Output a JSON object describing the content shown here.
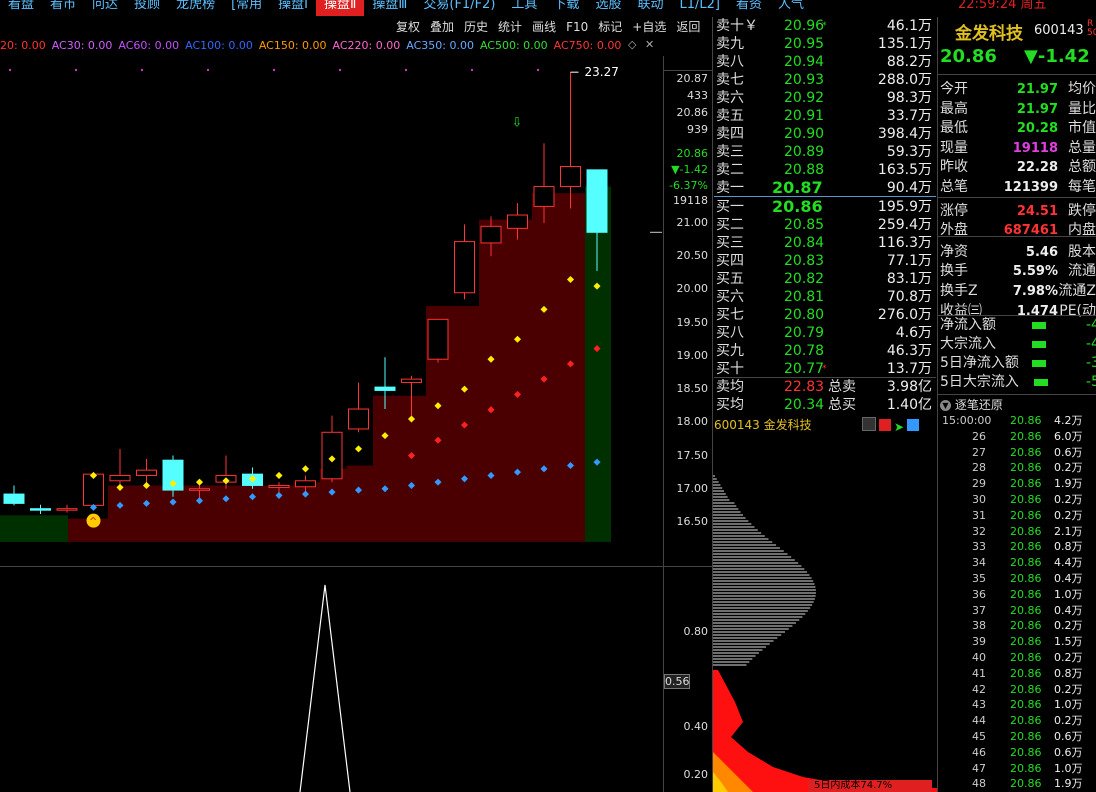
{
  "menubar": {
    "items": [
      "看盘",
      "看市",
      "问达",
      "投顾",
      "龙虎榜",
      "[常用",
      "操盘Ⅰ",
      "操盘Ⅱ",
      "操盘Ⅲ",
      "交易(F1/F2)",
      "工具",
      "下载",
      "选股",
      "联动",
      "L1/L2]",
      "看资",
      "人气"
    ],
    "active_index": 7,
    "time": "22:59:24 周五"
  },
  "toolbar": {
    "items": [
      "复权",
      "叠加",
      "历史",
      "统计",
      "画线",
      "F10",
      "标记",
      "+自选",
      "返回"
    ]
  },
  "ma_legend": [
    {
      "text": "20: 0.00",
      "color": "#ff3333"
    },
    {
      "text": "AC30: 0.00",
      "color": "#d060ff"
    },
    {
      "text": "AC60: 0.00",
      "color": "#c050ff"
    },
    {
      "text": "AC100: 0.00",
      "color": "#3366ff"
    },
    {
      "text": "AC150: 0.00",
      "color": "#ff9900"
    },
    {
      "text": "AC220: 0.00",
      "color": "#ff66cc"
    },
    {
      "text": "AC350: 0.00",
      "color": "#66aaff"
    },
    {
      "text": "AC500: 0.00",
      "color": "#33dd33"
    },
    {
      "text": "AC750: 0.00",
      "color": "#ff3333"
    }
  ],
  "chart_data": {
    "type": "candlestick",
    "title": "",
    "peak_label": "23.27",
    "price_axis": [
      "21.00",
      "20.50",
      "20.00",
      "19.50",
      "19.00",
      "18.50",
      "18.00",
      "17.50",
      "17.00",
      "16.50"
    ],
    "ylim": [
      16.2,
      23.4
    ],
    "candles": [
      {
        "o": 16.92,
        "h": 17.05,
        "l": 16.75,
        "c": 16.78
      },
      {
        "o": 16.7,
        "h": 16.76,
        "l": 16.62,
        "c": 16.68
      },
      {
        "o": 16.7,
        "h": 16.76,
        "l": 16.64,
        "c": 16.7
      },
      {
        "o": 16.75,
        "h": 17.2,
        "l": 16.72,
        "c": 17.22
      },
      {
        "o": 17.12,
        "h": 17.6,
        "l": 17.05,
        "c": 17.2
      },
      {
        "o": 17.2,
        "h": 17.45,
        "l": 17.05,
        "c": 17.28
      },
      {
        "o": 17.43,
        "h": 17.5,
        "l": 16.88,
        "c": 16.98
      },
      {
        "o": 17.0,
        "h": 17.1,
        "l": 16.85,
        "c": 17.0
      },
      {
        "o": 17.1,
        "h": 17.5,
        "l": 17.0,
        "c": 17.2
      },
      {
        "o": 17.22,
        "h": 17.32,
        "l": 17.0,
        "c": 17.05
      },
      {
        "o": 17.02,
        "h": 17.1,
        "l": 16.85,
        "c": 17.05
      },
      {
        "o": 17.03,
        "h": 17.2,
        "l": 16.95,
        "c": 17.12
      },
      {
        "o": 17.15,
        "h": 18.1,
        "l": 17.1,
        "c": 17.85
      },
      {
        "o": 17.9,
        "h": 18.6,
        "l": 17.85,
        "c": 18.2
      },
      {
        "o": 18.53,
        "h": 18.98,
        "l": 18.2,
        "c": 18.48
      },
      {
        "o": 18.6,
        "h": 18.7,
        "l": 18.0,
        "c": 18.65
      },
      {
        "o": 18.95,
        "h": 19.5,
        "l": 18.9,
        "c": 19.55
      },
      {
        "o": 19.95,
        "h": 20.98,
        "l": 19.85,
        "c": 20.72
      },
      {
        "o": 20.7,
        "h": 21.1,
        "l": 20.5,
        "c": 20.95
      },
      {
        "o": 20.92,
        "h": 21.3,
        "l": 20.75,
        "c": 21.12
      },
      {
        "o": 21.25,
        "h": 22.2,
        "l": 21.0,
        "c": 21.55
      },
      {
        "o": 21.55,
        "h": 23.27,
        "l": 21.22,
        "c": 21.85
      },
      {
        "o": 21.8,
        "h": 21.8,
        "l": 20.28,
        "c": 20.86
      }
    ],
    "yellow_dots": [
      17.2,
      17.02,
      17.05,
      17.08,
      17.1,
      17.12,
      17.15,
      17.2,
      17.3,
      17.45,
      17.6,
      17.8,
      18.05,
      18.25,
      18.5,
      18.95,
      19.25,
      19.7,
      20.15,
      20.05
    ],
    "blue_dots": [
      16.72,
      16.75,
      16.78,
      16.8,
      16.82,
      16.85,
      16.88,
      16.9,
      16.92,
      16.95,
      16.98,
      17.0,
      17.05,
      17.1,
      17.15,
      17.2,
      17.25,
      17.3,
      17.35,
      17.4
    ]
  },
  "price_panel": {
    "last_close": "20.87",
    "vol": "433",
    "price2": "20.86",
    "vol2": "939",
    "cur_price": "20.86",
    "change": "▼-1.42",
    "pct": "-6.37%",
    "cur_vol": "19118"
  },
  "lower_axis": [
    "0.80",
    "0.56",
    "0.40",
    "0.20"
  ],
  "order_book": {
    "sell": [
      {
        "label": "卖十￥",
        "price": "20.96",
        "flag": "*",
        "vol": "46.1万"
      },
      {
        "label": "卖九",
        "price": "20.95",
        "flag": "",
        "vol": "135.1万"
      },
      {
        "label": "卖八",
        "price": "20.94",
        "flag": "",
        "vol": "88.2万"
      },
      {
        "label": "卖七",
        "price": "20.93",
        "flag": "",
        "vol": "288.0万"
      },
      {
        "label": "卖六",
        "price": "20.92",
        "flag": "",
        "vol": "98.3万"
      },
      {
        "label": "卖五",
        "price": "20.91",
        "flag": "",
        "vol": "33.7万"
      },
      {
        "label": "卖四",
        "price": "20.90",
        "flag": "",
        "vol": "398.4万"
      },
      {
        "label": "卖三",
        "price": "20.89",
        "flag": "",
        "vol": "59.3万"
      },
      {
        "label": "卖二",
        "price": "20.88",
        "flag": "",
        "vol": "163.5万"
      },
      {
        "label": "卖一",
        "price": "20.87",
        "flag": "",
        "vol": "90.4万"
      }
    ],
    "buy": [
      {
        "label": "买一",
        "price": "20.86",
        "flag": "",
        "vol": "195.9万"
      },
      {
        "label": "买二",
        "price": "20.85",
        "flag": "",
        "vol": "259.4万"
      },
      {
        "label": "买三",
        "price": "20.84",
        "flag": "",
        "vol": "116.3万"
      },
      {
        "label": "买四",
        "price": "20.83",
        "flag": "",
        "vol": "77.1万"
      },
      {
        "label": "买五",
        "price": "20.82",
        "flag": "",
        "vol": "83.1万"
      },
      {
        "label": "买六",
        "price": "20.81",
        "flag": "",
        "vol": "70.8万"
      },
      {
        "label": "买七",
        "price": "20.80",
        "flag": "",
        "vol": "276.0万"
      },
      {
        "label": "买八",
        "price": "20.79",
        "flag": "",
        "vol": "4.6万"
      },
      {
        "label": "买九",
        "price": "20.78",
        "flag": "",
        "vol": "46.3万"
      },
      {
        "label": "买十",
        "price": "20.77",
        "flag": "*",
        "vol": "13.7万"
      }
    ],
    "avg": [
      {
        "label": "卖均",
        "price": "22.83",
        "lbl2": "总卖",
        "val": "3.98亿"
      },
      {
        "label": "买均",
        "price": "20.34",
        "lbl2": "总买",
        "val": "1.40亿"
      }
    ],
    "code_name": "600143 金发科技"
  },
  "stock": {
    "name": "金发科技",
    "code": "600143",
    "price": "20.86",
    "change": "▼-1.42"
  },
  "stats": [
    {
      "l": "今开",
      "v": "21.97",
      "c": "#22dd22",
      "r": "均价"
    },
    {
      "l": "最高",
      "v": "21.97",
      "c": "#22dd22",
      "r": "量比"
    },
    {
      "l": "最低",
      "v": "20.28",
      "c": "#22dd22",
      "r": "市值"
    },
    {
      "l": "现量",
      "v": "19118",
      "c": "#e040e0",
      "r": "总量"
    },
    {
      "l": "昨收",
      "v": "22.28",
      "c": "#eeeeee",
      "r": "总额"
    },
    {
      "l": "总笔",
      "v": "121399",
      "c": "#eeeeee",
      "r": "每笔"
    },
    {
      "l": "涨停",
      "v": "24.51",
      "c": "#ff3333",
      "r": "跌停"
    },
    {
      "l": "外盘",
      "v": "687461",
      "c": "#ff3333",
      "r": "内盘"
    },
    {
      "l": "净资",
      "v": "5.46",
      "c": "#eeeeee",
      "r": "股本"
    },
    {
      "l": "换手",
      "v": "5.59%",
      "c": "#eeeeee",
      "r": "流通"
    },
    {
      "l": "换手Z",
      "v": "7.98%",
      "c": "#eeeeee",
      "r": "流通Z"
    },
    {
      "l": "收益㈢",
      "v": "1.474",
      "c": "#eeeeee",
      "r": "PE(动"
    }
  ],
  "flows": [
    {
      "l": "净流入额",
      "v": "-4"
    },
    {
      "l": "大宗流入",
      "v": "-4"
    },
    {
      "l": "5日净流入额",
      "v": "-3"
    },
    {
      "l": "5日大宗流入",
      "v": "-5"
    }
  ],
  "ticks": {
    "header": "逐笔还原",
    "rows": [
      {
        "t": "15:00:00",
        "p": "20.86",
        "v": "4.2万"
      },
      {
        "t": "26",
        "p": "20.86",
        "v": "6.0万"
      },
      {
        "t": "27",
        "p": "20.86",
        "v": "0.6万"
      },
      {
        "t": "28",
        "p": "20.86",
        "v": "0.2万"
      },
      {
        "t": "29",
        "p": "20.86",
        "v": "1.9万"
      },
      {
        "t": "30",
        "p": "20.86",
        "v": "0.2万"
      },
      {
        "t": "31",
        "p": "20.86",
        "v": "0.2万"
      },
      {
        "t": "32",
        "p": "20.86",
        "v": "2.1万"
      },
      {
        "t": "33",
        "p": "20.86",
        "v": "0.8万"
      },
      {
        "t": "34",
        "p": "20.86",
        "v": "4.4万"
      },
      {
        "t": "35",
        "p": "20.86",
        "v": "0.4万"
      },
      {
        "t": "36",
        "p": "20.86",
        "v": "1.0万"
      },
      {
        "t": "37",
        "p": "20.86",
        "v": "0.4万"
      },
      {
        "t": "38",
        "p": "20.86",
        "v": "0.2万"
      },
      {
        "t": "39",
        "p": "20.86",
        "v": "1.5万"
      },
      {
        "t": "40",
        "p": "20.86",
        "v": "0.2万"
      },
      {
        "t": "41",
        "p": "20.86",
        "v": "0.8万"
      },
      {
        "t": "42",
        "p": "20.86",
        "v": "0.2万"
      },
      {
        "t": "43",
        "p": "20.86",
        "v": "1.0万"
      },
      {
        "t": "44",
        "p": "20.86",
        "v": "0.2万"
      },
      {
        "t": "45",
        "p": "20.86",
        "v": "0.6万"
      },
      {
        "t": "46",
        "p": "20.86",
        "v": "0.6万"
      },
      {
        "t": "47",
        "p": "20.86",
        "v": "1.0万"
      },
      {
        "t": "48",
        "p": "20.86",
        "v": "1.9万"
      }
    ]
  },
  "chip_label": "5日内成本74.7%"
}
